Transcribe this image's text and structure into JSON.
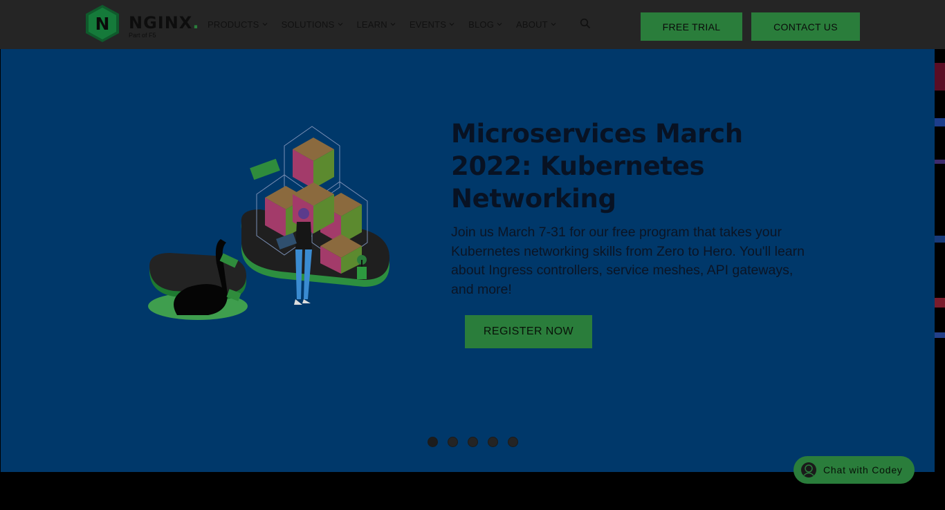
{
  "brand": {
    "logo_letter": "N",
    "name": "NGINX",
    "name_dot": ".",
    "tagline": "Part of F5"
  },
  "nav": {
    "items": [
      {
        "label": "PRODUCTS",
        "icon": "chevron-down-icon"
      },
      {
        "label": "SOLUTIONS",
        "icon": "chevron-down-icon"
      },
      {
        "label": "LEARN",
        "icon": "chevron-down-icon"
      },
      {
        "label": "EVENTS",
        "icon": "chevron-down-icon"
      },
      {
        "label": "BLOG",
        "icon": "chevron-down-icon"
      },
      {
        "label": "ABOUT",
        "icon": "chevron-down-icon"
      }
    ],
    "search_icon": "search-icon"
  },
  "header_buttons": {
    "free_trial": "FREE TRIAL",
    "contact_us": "CONTACT US"
  },
  "hero": {
    "title": "Microservices March 2022: Kubernetes Networking",
    "description": "Join us March 7-31 for our free program that takes your Kubernetes networking skills from Zero to Hero. You'll learn about Ingress controllers, service meshes, API gateways, and more!",
    "cta": "REGISTER NOW",
    "slides_count": 5,
    "active_slide": 1
  },
  "chat": {
    "label": "Chat with Codey",
    "icon": "chatbot-avatar-icon"
  },
  "colors": {
    "header_bg": "#252525",
    "hero_bg": "#00386a",
    "brand_green": "#2a7d3b",
    "text_dark": "#081223"
  }
}
